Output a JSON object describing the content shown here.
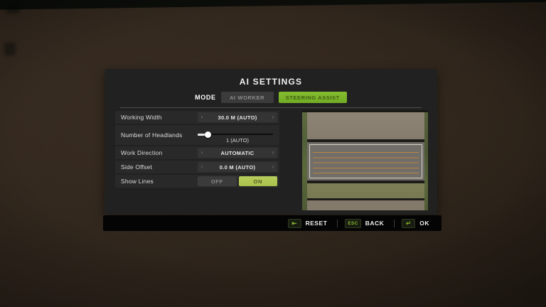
{
  "window": {
    "title": "AI SETTINGS"
  },
  "mode": {
    "label": "MODE",
    "tabs": [
      {
        "label": "AI WORKER",
        "active": false
      },
      {
        "label": "STEERING ASSIST",
        "active": true
      }
    ]
  },
  "glyphs": {
    "prev": "‹",
    "next": "›",
    "reset_key": "⇤",
    "ok_key": "↵"
  },
  "settings": {
    "working_width": {
      "label": "Working Width",
      "value": "30.0 M (AUTO)"
    },
    "headlands": {
      "label": "Number of Headlands",
      "value": "1 (AUTO)",
      "slider_percent": 13
    },
    "work_direction": {
      "label": "Work Direction",
      "value": "AUTOMATIC"
    },
    "side_offset": {
      "label": "Side Offset",
      "value": "0.0 M (AUTO)"
    },
    "show_lines": {
      "label": "Show Lines",
      "off_label": "OFF",
      "on_label": "ON",
      "state": "ON"
    }
  },
  "toolbar": {
    "reset_label": "RESET",
    "esc_key": "ESC",
    "back_label": "BACK",
    "ok_label": "OK"
  },
  "colors": {
    "accent_green": "#7bb42c",
    "toggle_on_green": "#b0c854",
    "key_text_green": "#86b22e"
  }
}
